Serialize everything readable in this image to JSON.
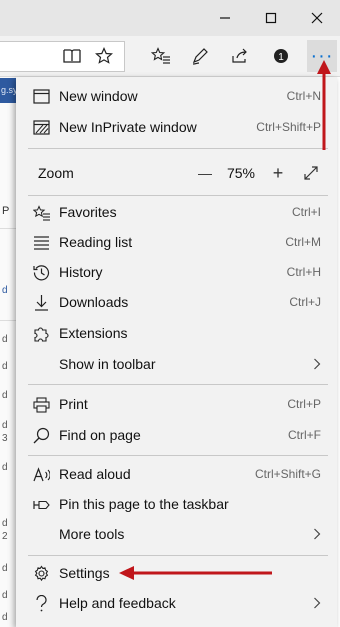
{
  "window": {
    "minimize_label": "—",
    "maximize_label": "☐",
    "close_label": "✕"
  },
  "toolbar": {
    "more_label": "···"
  },
  "page": {
    "fragments": [
      "g.sy",
      "P",
      "d",
      "d",
      "d",
      "d",
      "d",
      "3",
      "d",
      "d",
      "2",
      "d",
      "d",
      "d"
    ]
  },
  "menu": {
    "new_window": {
      "label": "New window",
      "shortcut": "Ctrl+N"
    },
    "new_private": {
      "label": "New InPrivate window",
      "shortcut": "Ctrl+Shift+P"
    },
    "zoom": {
      "label": "Zoom",
      "minus": "—",
      "value": "75%",
      "plus": "+"
    },
    "favorites": {
      "label": "Favorites",
      "shortcut": "Ctrl+I"
    },
    "reading_list": {
      "label": "Reading list",
      "shortcut": "Ctrl+M"
    },
    "history": {
      "label": "History",
      "shortcut": "Ctrl+H"
    },
    "downloads": {
      "label": "Downloads",
      "shortcut": "Ctrl+J"
    },
    "extensions": {
      "label": "Extensions"
    },
    "show_in_toolbar": {
      "label": "Show in toolbar"
    },
    "print": {
      "label": "Print",
      "shortcut": "Ctrl+P"
    },
    "find_on_page": {
      "label": "Find on page",
      "shortcut": "Ctrl+F"
    },
    "read_aloud": {
      "label": "Read aloud",
      "shortcut": "Ctrl+Shift+G"
    },
    "pin_taskbar": {
      "label": "Pin this page to the taskbar"
    },
    "more_tools": {
      "label": "More tools"
    },
    "settings": {
      "label": "Settings"
    },
    "help": {
      "label": "Help and feedback"
    }
  },
  "colors": {
    "annotation_arrow": "#c0161b",
    "more_button_accent": "#0a6fcf"
  }
}
